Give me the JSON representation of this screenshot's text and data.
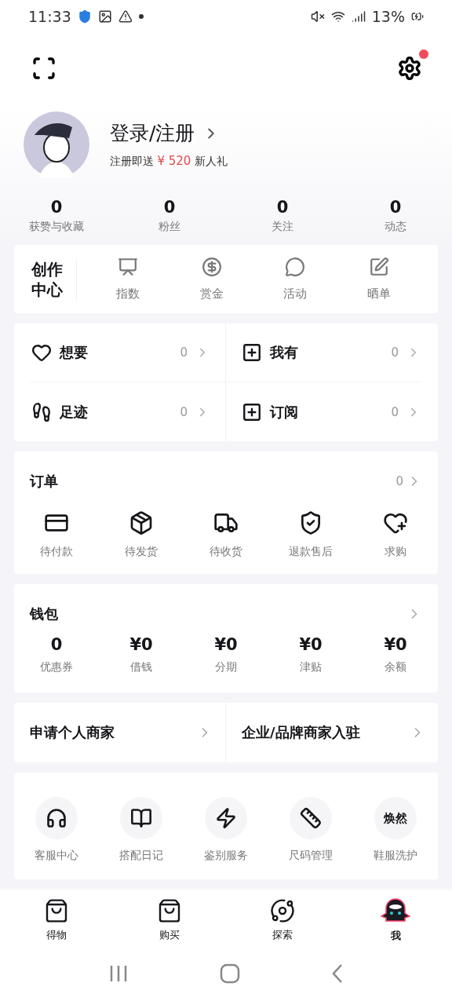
{
  "status_bar": {
    "time": "11:33",
    "battery": "13%"
  },
  "header": {
    "settings_badge": true
  },
  "profile": {
    "login": "登录/注册",
    "promo_prefix": "注册即送",
    "promo_amount": "¥ 520",
    "promo_suffix": "新人礼"
  },
  "stats": [
    {
      "value": "0",
      "label": "获赞与收藏"
    },
    {
      "value": "0",
      "label": "粉丝"
    },
    {
      "value": "0",
      "label": "关注"
    },
    {
      "value": "0",
      "label": "动态"
    }
  ],
  "creator": {
    "title": "创作中心",
    "items": [
      {
        "label": "指数"
      },
      {
        "label": "赏金"
      },
      {
        "label": "活动"
      },
      {
        "label": "晒单"
      }
    ]
  },
  "quick": [
    {
      "label": "想要",
      "count": "0"
    },
    {
      "label": "我有",
      "count": "0"
    },
    {
      "label": "足迹",
      "count": "0"
    },
    {
      "label": "订阅",
      "count": "0"
    }
  ],
  "orders": {
    "title": "订单",
    "count": "0",
    "items": [
      {
        "label": "待付款"
      },
      {
        "label": "待发货"
      },
      {
        "label": "待收货"
      },
      {
        "label": "退款售后"
      },
      {
        "label": "求购"
      }
    ]
  },
  "wallet": {
    "title": "钱包",
    "items": [
      {
        "value": "0",
        "label": "优惠券"
      },
      {
        "value": "¥0",
        "label": "借钱"
      },
      {
        "value": "¥0",
        "label": "分期"
      },
      {
        "value": "¥0",
        "label": "津贴"
      },
      {
        "value": "¥0",
        "label": "余额"
      }
    ]
  },
  "merchant": [
    {
      "label": "申请个人商家"
    },
    {
      "label": "企业/品牌商家入驻"
    }
  ],
  "services": [
    {
      "kind": "icon",
      "label": "客服中心"
    },
    {
      "kind": "icon",
      "label": "搭配日记"
    },
    {
      "kind": "icon",
      "label": "鉴别服务"
    },
    {
      "kind": "icon",
      "label": "尺码管理"
    },
    {
      "kind": "text",
      "icon_text": "焕然",
      "label": "鞋服洗护"
    }
  ],
  "tabs": [
    {
      "label": "得物",
      "selected": false
    },
    {
      "label": "购买",
      "selected": false
    },
    {
      "label": "探索",
      "selected": false
    },
    {
      "label": "我",
      "selected": true
    }
  ]
}
